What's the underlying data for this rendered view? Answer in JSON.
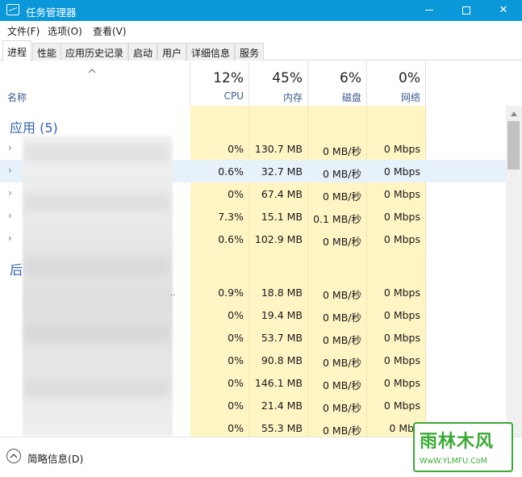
{
  "window": {
    "title": "任务管理器"
  },
  "menu": [
    "文件(F)",
    "选项(O)",
    "查看(V)"
  ],
  "tabs": [
    {
      "label": "进程",
      "active": true
    },
    {
      "label": "性能",
      "active": false
    },
    {
      "label": "应用历史记录",
      "active": false
    },
    {
      "label": "启动",
      "active": false
    },
    {
      "label": "用户",
      "active": false
    },
    {
      "label": "详细信息",
      "active": false
    },
    {
      "label": "服务",
      "active": false
    }
  ],
  "columns": {
    "name": "名称",
    "cpu": {
      "pct": "12%",
      "label": "CPU"
    },
    "memory": {
      "pct": "45%",
      "label": "内存"
    },
    "disk": {
      "pct": "6%",
      "label": "磁盘"
    },
    "network": {
      "pct": "0%",
      "label": "网络"
    }
  },
  "groups": {
    "apps": {
      "title": "应用 (5)",
      "rows": [
        {
          "cpu": "0%",
          "mem": "130.7 MB",
          "disk": "0 MB/秒",
          "net": "0 Mbps"
        },
        {
          "cpu": "0.6%",
          "mem": "32.7 MB",
          "disk": "0 MB/秒",
          "net": "0 Mbps"
        },
        {
          "cpu": "0%",
          "mem": "67.4 MB",
          "disk": "0 MB/秒",
          "net": "0 Mbps"
        },
        {
          "cpu": "7.3%",
          "mem": "15.1 MB",
          "disk": "0.1 MB/秒",
          "net": "0 Mbps"
        },
        {
          "cpu": "0.6%",
          "mem": "102.9 MB",
          "disk": "0 MB/秒",
          "net": "0 Mbps"
        }
      ]
    },
    "background": {
      "title": "后",
      "rows": [
        {
          "cpu": "0.9%",
          "mem": "18.8 MB",
          "disk": "0 MB/秒",
          "net": "0 Mbps"
        },
        {
          "cpu": "0%",
          "mem": "19.4 MB",
          "disk": "0 MB/秒",
          "net": "0 Mbps"
        },
        {
          "cpu": "0%",
          "mem": "53.7 MB",
          "disk": "0 MB/秒",
          "net": "0 Mbps"
        },
        {
          "cpu": "0%",
          "mem": "90.8 MB",
          "disk": "0 MB/秒",
          "net": "0 Mbps"
        },
        {
          "cpu": "0%",
          "mem": "146.1 MB",
          "disk": "0 MB/秒",
          "net": "0 Mbps"
        },
        {
          "cpu": "0%",
          "mem": "21.4 MB",
          "disk": "0 MB/秒",
          "net": "0 Mbps"
        },
        {
          "cpu": "0%",
          "mem": "55.3 MB",
          "disk": "0 MB/秒",
          "net": "0 Mbp"
        }
      ]
    }
  },
  "footer": {
    "fewer_details": "简略信息(D)"
  },
  "watermark": {
    "main": "雨林木风",
    "sub": "WwW.YLMFU.CoM"
  },
  "colors": {
    "titlebar": "#0a98d8",
    "accent_text": "#2e62ad",
    "data_bg": "#fff4c4"
  }
}
